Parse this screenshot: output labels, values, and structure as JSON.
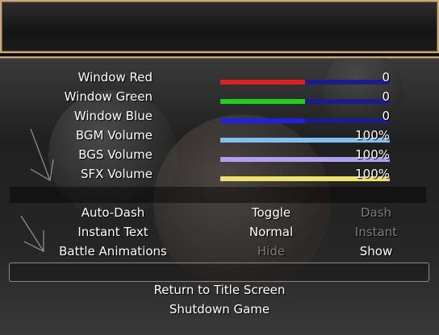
{
  "gauges": [
    {
      "label": "Window Red",
      "value_text": "0",
      "fill": 0.5,
      "color": "#e02020"
    },
    {
      "label": "Window Green",
      "value_text": "0",
      "fill": 0.5,
      "color": "#20d020"
    },
    {
      "label": "Window Blue",
      "value_text": "0",
      "fill": 0.5,
      "color": "#2020e0"
    },
    {
      "label": "BGM Volume",
      "value_text": "100%",
      "fill": 1.0,
      "color": "#80c0f0"
    },
    {
      "label": "BGS Volume",
      "value_text": "100%",
      "fill": 1.0,
      "color": "#b0a0f0"
    },
    {
      "label": "SFX Volume",
      "value_text": "100%",
      "fill": 1.0,
      "color": "#f0e070"
    }
  ],
  "options": [
    {
      "label": "Auto-Dash",
      "option_a": "Toggle",
      "option_b": "Dash",
      "selected": "a"
    },
    {
      "label": "Instant Text",
      "option_a": "Normal",
      "option_b": "Instant",
      "selected": "a"
    },
    {
      "label": "Battle Animations",
      "option_a": "Hide",
      "option_b": "Show",
      "selected": "b"
    }
  ],
  "commands": {
    "return_to_title": "Return to Title Screen",
    "shutdown": "Shutdown Game"
  },
  "colors": {
    "border": "#c8a878",
    "gauge_background": "#1c1c8a",
    "disabled_text": "#7d7d7d"
  }
}
